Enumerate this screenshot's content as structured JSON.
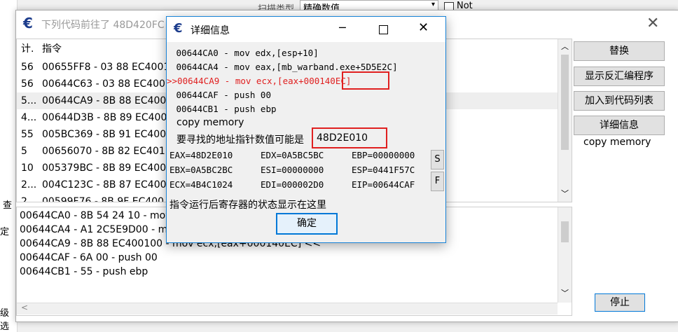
{
  "bg": {
    "scan_type_label": "扫描类型",
    "scan_type_value": "精确数值",
    "not_label": "Not",
    "side_labels": [
      "查",
      "定",
      "级选"
    ]
  },
  "main_window": {
    "title": "下列代码前往了 48D420FC",
    "columns": [
      "计.",
      "指令"
    ],
    "rows": [
      {
        "count": "56",
        "instr": "00655FF8 - 03 88 EC4001"
      },
      {
        "count": "56",
        "instr": "00644C63 - 03 88 EC400"
      },
      {
        "count": "5...",
        "instr": "00644CA9 - 8B 88 EC400"
      },
      {
        "count": "4...",
        "instr": "00644D3B - 8B 89 EC400"
      },
      {
        "count": "55",
        "instr": "005BC369 - 8B 91 EC400"
      },
      {
        "count": "5",
        "instr": "00656070 - 8B 82 EC401"
      },
      {
        "count": "10",
        "instr": "005379BC - 8B 89 EC400"
      },
      {
        "count": "2...",
        "instr": "004C123C - 8B 87 EC400"
      },
      {
        "count": "2",
        "instr": "00599F76 - 8B 9F EC400"
      }
    ],
    "buttons": {
      "replace": "替换",
      "show_disasm": "显示反汇编程序",
      "add_to_codelist": "加入到代码列表",
      "details": "详细信息",
      "stop": "停止"
    },
    "copy_memory": "copy memory",
    "code_lines": [
      "00644CA0 - 8B 54 24 10  - mov edx,[esp+10]",
      "00644CA4 - A1 2C5E9D00 - mov eax,[mb_warband.exe+5D5E2C]",
      "00644CA9 - 8B 88 EC400100 - mov ecx,[eax+000140EC] <<",
      "00644CAF - 6A 00 - push 00",
      "00644CB1 - 55 - push ebp"
    ]
  },
  "dialog": {
    "title": "详细信息",
    "asm_lines": [
      " 00644CA0 - mov edx,[esp+10]",
      " 00644CA4 - mov eax,[mb_warband.exe+5D5E2C]",
      ">>00644CA9 - mov ecx,[eax+000140EC]",
      " 00644CAF - push 00",
      " 00644CB1 - push ebp"
    ],
    "copy_memory": "copy memory",
    "pointer_hint": "要寻找的地址指针数值可能是",
    "pointer_value": "48D2E010",
    "registers": {
      "eax": "EAX=48D2E010",
      "edx": "EDX=0A5BC5BC",
      "ebp": "EBP=00000000",
      "ebx": "EBX=0A5BC2BC",
      "esi": "ESI=00000000",
      "esp": "ESP=0441F57C",
      "ecx": "ECX=4B4C1024",
      "edi": "EDI=000002D0",
      "eip": "EIP=00644CAF"
    },
    "s_button": "S",
    "f_button": "F",
    "status_text": "指令运行后寄存器的状态显示在这里",
    "ok_button": "确定",
    "highlight_color": "#e02020"
  }
}
